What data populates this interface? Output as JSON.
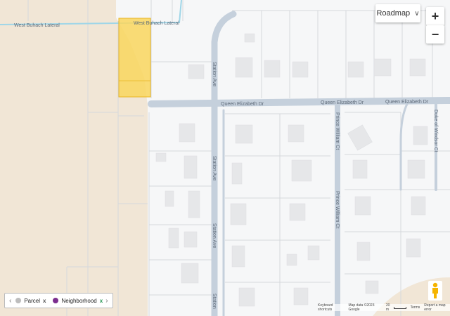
{
  "map": {
    "type_control": {
      "label": "Roadmap",
      "chevron_icon": "chevron-down-icon"
    },
    "zoom": {
      "in_label": "+",
      "out_label": "−"
    },
    "streets": [
      {
        "id": "queen-elizabeth-1",
        "label": "Queen Elizabeth Dr"
      },
      {
        "id": "queen-elizabeth-2",
        "label": "Queen Elizabeth Dr"
      },
      {
        "id": "queen-elizabeth-3",
        "label": "Queen Elizabeth Dr"
      },
      {
        "id": "station-ave-1",
        "label": "Station Ave"
      },
      {
        "id": "station-ave-2",
        "label": "Station Ave"
      },
      {
        "id": "station-ave-3",
        "label": "Station Ave"
      },
      {
        "id": "station-ave-4",
        "label": "Station"
      },
      {
        "id": "prince-william-1",
        "label": "Prince William Ct"
      },
      {
        "id": "prince-william-2",
        "label": "Prince William Ct"
      },
      {
        "id": "duke-of-windsor",
        "label": "Duke of Windsor Ct"
      },
      {
        "id": "west-buhach-1",
        "label": "West Buhach Lateral"
      },
      {
        "id": "west-buhach-2",
        "label": "West Buhach Lateral"
      }
    ],
    "colors": {
      "background": "#f6f7f8",
      "tan_area": "#f1e6d6",
      "road": "#c5d0dc",
      "parcel_line": "#d5d8dc",
      "building": "#e6e7e9",
      "canal": "#9fd6e8",
      "highlight_fill": "#f9d65e",
      "highlight_stroke": "#e9b522",
      "legend_parcel": "#bdbdbd",
      "legend_neighborhood": "#7b2d8e"
    }
  },
  "legend": {
    "items": [
      {
        "label": "Parcel",
        "close": "x"
      },
      {
        "label": "Neighborhood",
        "close": "x"
      }
    ],
    "prev_arrow": "‹",
    "next_arrow": "›"
  },
  "attribution": {
    "shortcuts": "Keyboard shortcuts",
    "map_data": "Map data ©2023 Google",
    "scale": "20 m",
    "terms": "Terms",
    "report": "Report a map error"
  }
}
